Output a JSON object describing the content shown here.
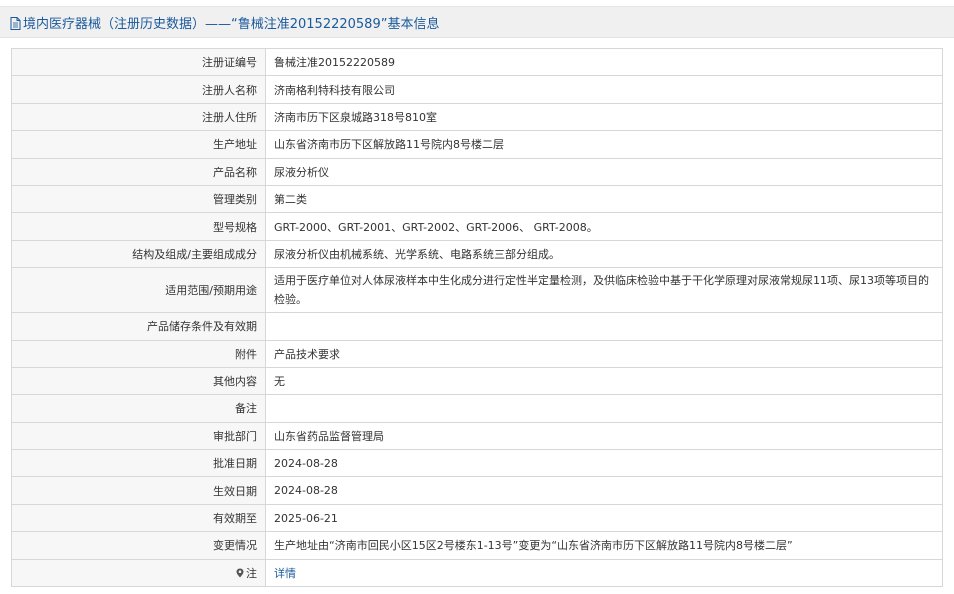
{
  "header": {
    "title": "境内医疗器械（注册历史数据）——“鲁械注准20152220589”基本信息"
  },
  "rows": [
    {
      "label": "注册证编号",
      "value": "鲁械注准20152220589"
    },
    {
      "label": "注册人名称",
      "value": "济南格利特科技有限公司"
    },
    {
      "label": "注册人住所",
      "value": "济南市历下区泉城路318号810室"
    },
    {
      "label": "生产地址",
      "value": "山东省济南市历下区解放路11号院内8号楼二层"
    },
    {
      "label": "产品名称",
      "value": "尿液分析仪"
    },
    {
      "label": "管理类别",
      "value": "第二类"
    },
    {
      "label": "型号规格",
      "value": "GRT-2000、GRT-2001、GRT-2002、GRT-2006、 GRT-2008。"
    },
    {
      "label": "结构及组成/主要组成成分",
      "value": "尿液分析仪由机械系统、光学系统、电路系统三部分组成。"
    },
    {
      "label": "适用范围/预期用途",
      "value": "适用于医疗单位对人体尿液样本中生化成分进行定性半定量检测，及供临床检验中基于干化学原理对尿液常规尿11项、尿13项等项目的检验。"
    },
    {
      "label": "产品储存条件及有效期",
      "value": ""
    },
    {
      "label": "附件",
      "value": "产品技术要求"
    },
    {
      "label": "其他内容",
      "value": "无"
    },
    {
      "label": "备注",
      "value": ""
    },
    {
      "label": "审批部门",
      "value": "山东省药品监督管理局"
    },
    {
      "label": "批准日期",
      "value": "2024-08-28"
    },
    {
      "label": "生效日期",
      "value": "2024-08-28"
    },
    {
      "label": "有效期至",
      "value": "2025-06-21"
    },
    {
      "label": "变更情况",
      "value": "生产地址由“济南市回民小区15区2号楼东1-13号”变更为“山东省济南市历下区解放路11号院内8号楼二层”"
    }
  ],
  "note_row": {
    "label": "注",
    "link": "详情",
    "icon": "location-pin-icon"
  },
  "colors": {
    "accent": "#1a5a9c",
    "header_bg": "#f0f0f0",
    "label_bg": "#f7f7f7",
    "border": "#d7d7d7"
  }
}
